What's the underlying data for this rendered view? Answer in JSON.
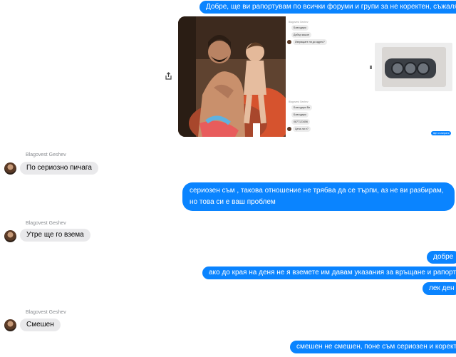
{
  "sender_name": "Blagovest Geshev",
  "messages": {
    "m1": "Добре, ще ви рапортувам по всички форуми и групи за не коректен, съжалявам",
    "m2": "По сериозно пичага",
    "m3": "сериозен съм , такова отношение не трябва да се търпи, аз не ви разбирам, но това си е ваш проблем",
    "m4": "Утре ще го взема",
    "m5": "добре",
    "m6": "ако до края на деня не я вземете им давам указания за връщане и рапортувам",
    "m7": "лек ден",
    "m8": "Смешен",
    "m9": "смешен не смешен, поне съм сериозен и коректен"
  },
  "attachment": {
    "shot_messages": [
      "Благодаря",
      "Добър кашон",
      "Изпращате ли до адрес?",
      "Благодаря Ви",
      "Благодаря",
      "0877123456",
      "Цена ли е?"
    ],
    "shot_blue": "Ще ги изпратя"
  },
  "colors": {
    "outgoing": "#0a84ff",
    "incoming": "#e9e9eb",
    "sender": "#8a8d91"
  },
  "icons": {
    "share": "share-icon",
    "avatar": "avatar"
  }
}
